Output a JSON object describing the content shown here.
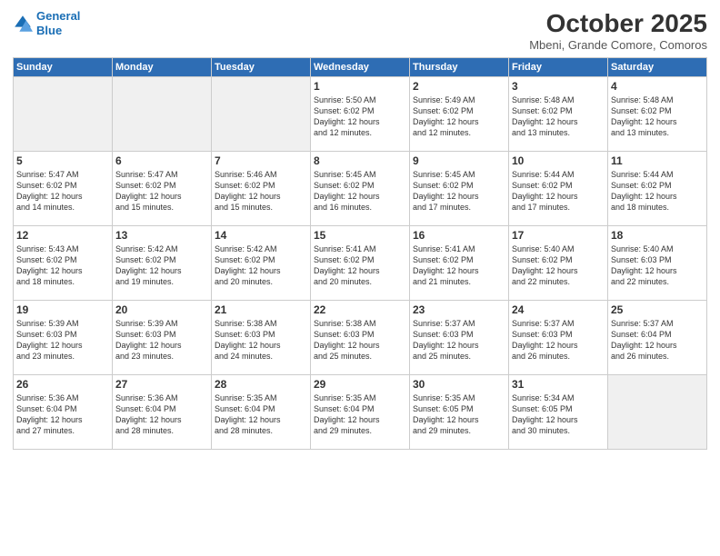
{
  "header": {
    "logo_line1": "General",
    "logo_line2": "Blue",
    "month": "October 2025",
    "location": "Mbeni, Grande Comore, Comoros"
  },
  "weekdays": [
    "Sunday",
    "Monday",
    "Tuesday",
    "Wednesday",
    "Thursday",
    "Friday",
    "Saturday"
  ],
  "weeks": [
    [
      {
        "day": "",
        "info": ""
      },
      {
        "day": "",
        "info": ""
      },
      {
        "day": "",
        "info": ""
      },
      {
        "day": "1",
        "info": "Sunrise: 5:50 AM\nSunset: 6:02 PM\nDaylight: 12 hours\nand 12 minutes."
      },
      {
        "day": "2",
        "info": "Sunrise: 5:49 AM\nSunset: 6:02 PM\nDaylight: 12 hours\nand 12 minutes."
      },
      {
        "day": "3",
        "info": "Sunrise: 5:48 AM\nSunset: 6:02 PM\nDaylight: 12 hours\nand 13 minutes."
      },
      {
        "day": "4",
        "info": "Sunrise: 5:48 AM\nSunset: 6:02 PM\nDaylight: 12 hours\nand 13 minutes."
      }
    ],
    [
      {
        "day": "5",
        "info": "Sunrise: 5:47 AM\nSunset: 6:02 PM\nDaylight: 12 hours\nand 14 minutes."
      },
      {
        "day": "6",
        "info": "Sunrise: 5:47 AM\nSunset: 6:02 PM\nDaylight: 12 hours\nand 15 minutes."
      },
      {
        "day": "7",
        "info": "Sunrise: 5:46 AM\nSunset: 6:02 PM\nDaylight: 12 hours\nand 15 minutes."
      },
      {
        "day": "8",
        "info": "Sunrise: 5:45 AM\nSunset: 6:02 PM\nDaylight: 12 hours\nand 16 minutes."
      },
      {
        "day": "9",
        "info": "Sunrise: 5:45 AM\nSunset: 6:02 PM\nDaylight: 12 hours\nand 17 minutes."
      },
      {
        "day": "10",
        "info": "Sunrise: 5:44 AM\nSunset: 6:02 PM\nDaylight: 12 hours\nand 17 minutes."
      },
      {
        "day": "11",
        "info": "Sunrise: 5:44 AM\nSunset: 6:02 PM\nDaylight: 12 hours\nand 18 minutes."
      }
    ],
    [
      {
        "day": "12",
        "info": "Sunrise: 5:43 AM\nSunset: 6:02 PM\nDaylight: 12 hours\nand 18 minutes."
      },
      {
        "day": "13",
        "info": "Sunrise: 5:42 AM\nSunset: 6:02 PM\nDaylight: 12 hours\nand 19 minutes."
      },
      {
        "day": "14",
        "info": "Sunrise: 5:42 AM\nSunset: 6:02 PM\nDaylight: 12 hours\nand 20 minutes."
      },
      {
        "day": "15",
        "info": "Sunrise: 5:41 AM\nSunset: 6:02 PM\nDaylight: 12 hours\nand 20 minutes."
      },
      {
        "day": "16",
        "info": "Sunrise: 5:41 AM\nSunset: 6:02 PM\nDaylight: 12 hours\nand 21 minutes."
      },
      {
        "day": "17",
        "info": "Sunrise: 5:40 AM\nSunset: 6:02 PM\nDaylight: 12 hours\nand 22 minutes."
      },
      {
        "day": "18",
        "info": "Sunrise: 5:40 AM\nSunset: 6:03 PM\nDaylight: 12 hours\nand 22 minutes."
      }
    ],
    [
      {
        "day": "19",
        "info": "Sunrise: 5:39 AM\nSunset: 6:03 PM\nDaylight: 12 hours\nand 23 minutes."
      },
      {
        "day": "20",
        "info": "Sunrise: 5:39 AM\nSunset: 6:03 PM\nDaylight: 12 hours\nand 23 minutes."
      },
      {
        "day": "21",
        "info": "Sunrise: 5:38 AM\nSunset: 6:03 PM\nDaylight: 12 hours\nand 24 minutes."
      },
      {
        "day": "22",
        "info": "Sunrise: 5:38 AM\nSunset: 6:03 PM\nDaylight: 12 hours\nand 25 minutes."
      },
      {
        "day": "23",
        "info": "Sunrise: 5:37 AM\nSunset: 6:03 PM\nDaylight: 12 hours\nand 25 minutes."
      },
      {
        "day": "24",
        "info": "Sunrise: 5:37 AM\nSunset: 6:03 PM\nDaylight: 12 hours\nand 26 minutes."
      },
      {
        "day": "25",
        "info": "Sunrise: 5:37 AM\nSunset: 6:04 PM\nDaylight: 12 hours\nand 26 minutes."
      }
    ],
    [
      {
        "day": "26",
        "info": "Sunrise: 5:36 AM\nSunset: 6:04 PM\nDaylight: 12 hours\nand 27 minutes."
      },
      {
        "day": "27",
        "info": "Sunrise: 5:36 AM\nSunset: 6:04 PM\nDaylight: 12 hours\nand 28 minutes."
      },
      {
        "day": "28",
        "info": "Sunrise: 5:35 AM\nSunset: 6:04 PM\nDaylight: 12 hours\nand 28 minutes."
      },
      {
        "day": "29",
        "info": "Sunrise: 5:35 AM\nSunset: 6:04 PM\nDaylight: 12 hours\nand 29 minutes."
      },
      {
        "day": "30",
        "info": "Sunrise: 5:35 AM\nSunset: 6:05 PM\nDaylight: 12 hours\nand 29 minutes."
      },
      {
        "day": "31",
        "info": "Sunrise: 5:34 AM\nSunset: 6:05 PM\nDaylight: 12 hours\nand 30 minutes."
      },
      {
        "day": "",
        "info": ""
      }
    ]
  ]
}
